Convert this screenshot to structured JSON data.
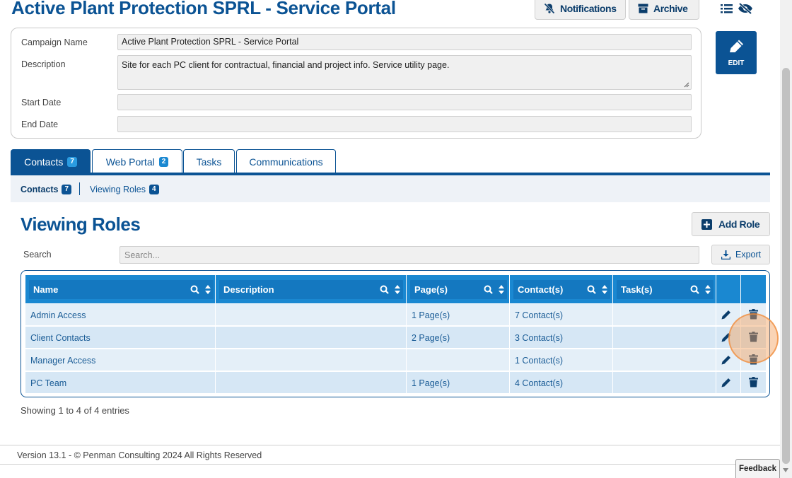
{
  "header": {
    "title": "Active Plant Protection SPRL - Service Portal",
    "notifications_label": "Notifications",
    "archive_label": "Archive"
  },
  "campaign": {
    "name_label": "Campaign Name",
    "name_value": "Active Plant Protection SPRL - Service Portal",
    "description_label": "Description",
    "description_value": "Site for each PC client for contractual, financial and project info. Service utility page.",
    "start_date_label": "Start Date",
    "start_date_value": "",
    "end_date_label": "End Date",
    "end_date_value": "",
    "edit_label": "EDIT"
  },
  "tabs": [
    {
      "label": "Contacts",
      "badge": "7",
      "active": true
    },
    {
      "label": "Web Portal",
      "badge": "2",
      "active": false
    },
    {
      "label": "Tasks",
      "badge": "",
      "active": false
    },
    {
      "label": "Communications",
      "badge": "",
      "active": false
    }
  ],
  "subnav": [
    {
      "label": "Contacts",
      "badge": "7",
      "active": true
    },
    {
      "label": "Viewing Roles",
      "badge": "4",
      "active": false
    }
  ],
  "roles": {
    "title": "Viewing Roles",
    "add_label": "Add Role",
    "search_label": "Search",
    "search_placeholder": "Search...",
    "search_value": "",
    "export_label": "Export",
    "columns": [
      "Name",
      "Description",
      "Page(s)",
      "Contact(s)",
      "Task(s)"
    ],
    "rows": [
      {
        "name": "Admin Access",
        "description": "",
        "pages": "1 Page(s)",
        "contacts": "7 Contact(s)",
        "tasks": ""
      },
      {
        "name": "Client Contacts",
        "description": "",
        "pages": "2 Page(s)",
        "contacts": "3 Contact(s)",
        "tasks": ""
      },
      {
        "name": "Manager Access",
        "description": "",
        "pages": "",
        "contacts": "1 Contact(s)",
        "tasks": ""
      },
      {
        "name": "PC Team",
        "description": "",
        "pages": "1 Page(s)",
        "contacts": "4 Contact(s)",
        "tasks": ""
      }
    ],
    "entries_text": "Showing 1 to 4 of 4 entries"
  },
  "footer": {
    "text": "Version 13.1 - © Penman Consulting 2024 All Rights Reserved",
    "feedback_label": "Feedback"
  },
  "colors": {
    "primary": "#0b5394",
    "table_header": "#1a88d1",
    "highlight": "#f08c3c"
  }
}
